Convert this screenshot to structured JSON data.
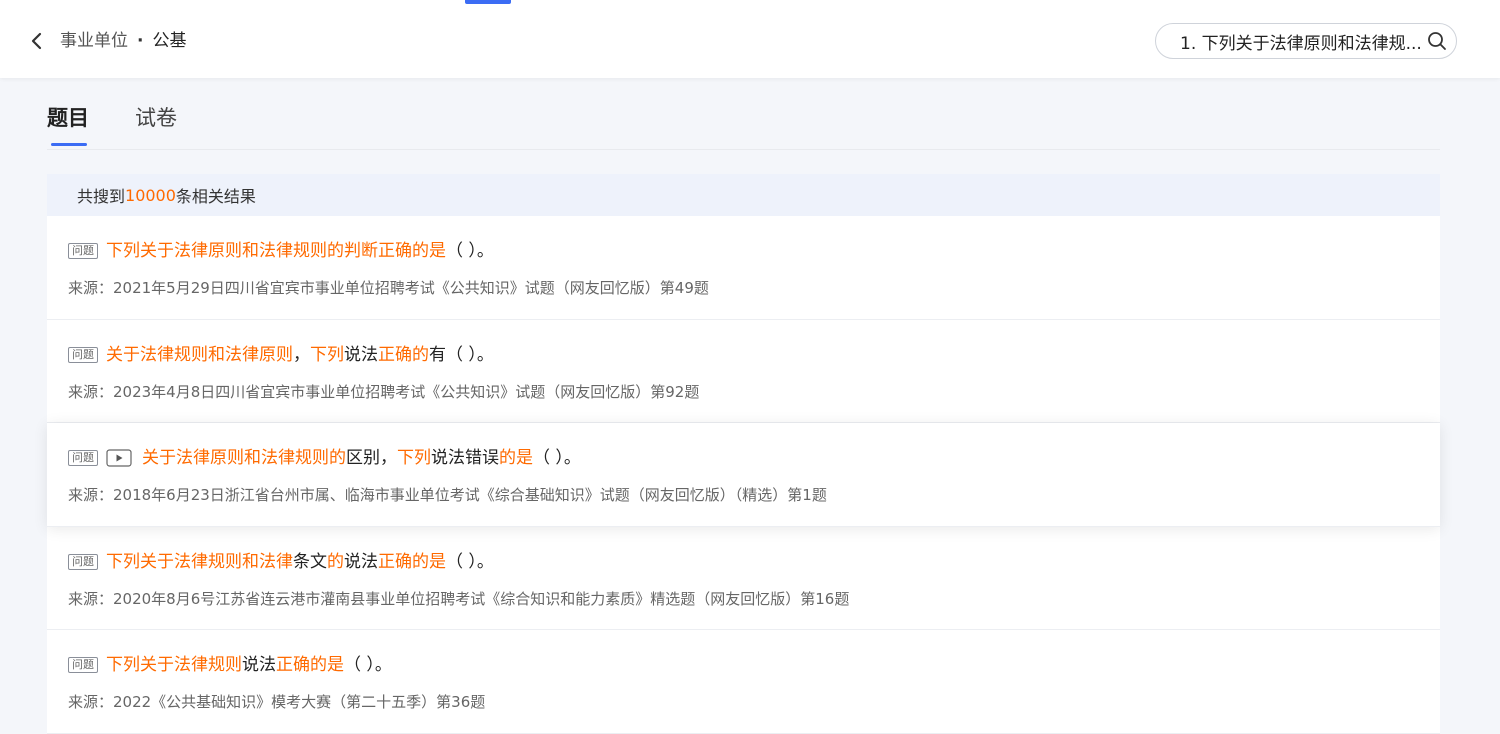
{
  "header": {
    "breadcrumb_parent": "事业单位",
    "breadcrumb_separator": "·",
    "breadcrumb_current": "公基",
    "search_value": "1. 下列关于法律原则和法律规..."
  },
  "tabs": [
    {
      "label": "题目",
      "active": true
    },
    {
      "label": "试卷",
      "active": false
    }
  ],
  "results_summary": {
    "prefix": "共搜到",
    "count": "10000",
    "suffix": "条相关结果"
  },
  "tag_label": "问题",
  "colors": {
    "accent": "#3b6cf4",
    "highlight": "#ff6a00",
    "header_bg": "#eef2fb"
  },
  "results": [
    {
      "has_video": false,
      "title": [
        {
          "t": "下列关于法律原则和法律规则的判断正确的是",
          "h": true
        },
        {
          "t": "（  ）。",
          "h": false
        }
      ],
      "source": "来源：2021年5月29日四川省宜宾市事业单位招聘考试《公共知识》试题（网友回忆版）第49题"
    },
    {
      "has_video": false,
      "title": [
        {
          "t": "关于法律规则和法律原则",
          "h": true
        },
        {
          "t": "，",
          "h": false
        },
        {
          "t": "下列",
          "h": true
        },
        {
          "t": "说法",
          "h": false
        },
        {
          "t": "正确的",
          "h": true
        },
        {
          "t": "有（  ）。",
          "h": false
        }
      ],
      "source": "来源：2023年4月8日四川省宜宾市事业单位招聘考试《公共知识》试题（网友回忆版）第92题"
    },
    {
      "has_video": true,
      "title": [
        {
          "t": "关于法律原则和法律规则的",
          "h": true
        },
        {
          "t": "区别，",
          "h": false
        },
        {
          "t": "下列",
          "h": true
        },
        {
          "t": "说法错误",
          "h": false
        },
        {
          "t": "的是",
          "h": true
        },
        {
          "t": "（  ）。",
          "h": false
        }
      ],
      "source": "来源：2018年6月23日浙江省台州市属、临海市事业单位考试《综合基础知识》试题（网友回忆版）（精选）第1题"
    },
    {
      "has_video": false,
      "title": [
        {
          "t": "下列关于法律规则和法律",
          "h": true
        },
        {
          "t": "条文",
          "h": false
        },
        {
          "t": "的",
          "h": true
        },
        {
          "t": "说法",
          "h": false
        },
        {
          "t": "正确的是",
          "h": true
        },
        {
          "t": "（  ）。",
          "h": false
        }
      ],
      "source": "来源：2020年8月6号江苏省连云港市灌南县事业单位招聘考试《综合知识和能力素质》精选题（网友回忆版）第16题"
    },
    {
      "has_video": false,
      "title": [
        {
          "t": "下列关于法律规则",
          "h": true
        },
        {
          "t": "说法",
          "h": false
        },
        {
          "t": "正确的是",
          "h": true
        },
        {
          "t": "（  ）。",
          "h": false
        }
      ],
      "source": "来源：2022《公共基础知识》模考大赛（第二十五季）第36题"
    }
  ]
}
